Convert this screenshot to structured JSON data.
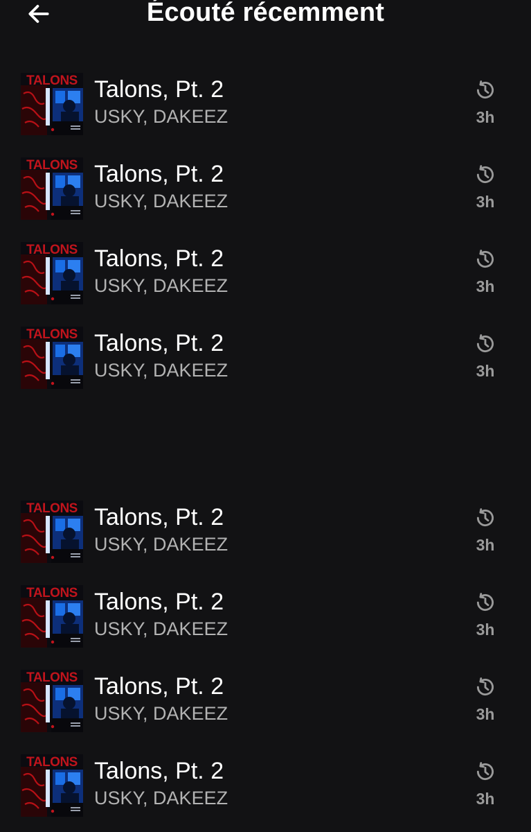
{
  "header": {
    "back_icon": "arrow-left-icon",
    "title": "Écouté récemment"
  },
  "tracks": [
    {
      "title": "Talons, Pt. 2",
      "artist": "USKY, DAKEEZ",
      "time": "3h",
      "cover_text": "TALONS",
      "icon": "history-icon"
    },
    {
      "title": "Talons, Pt. 2",
      "artist": "USKY, DAKEEZ",
      "time": "3h",
      "cover_text": "TALONS",
      "icon": "history-icon"
    },
    {
      "title": "Talons, Pt. 2",
      "artist": "USKY, DAKEEZ",
      "time": "3h",
      "cover_text": "TALONS",
      "icon": "history-icon"
    },
    {
      "title": "Talons, Pt. 2",
      "artist": "USKY, DAKEEZ",
      "time": "3h",
      "cover_text": "TALONS",
      "icon": "history-icon"
    },
    {
      "title": "Talons, Pt. 2",
      "artist": "USKY, DAKEEZ",
      "time": "3h",
      "cover_text": "TALONS",
      "icon": "history-icon"
    },
    {
      "title": "Talons, Pt. 2",
      "artist": "USKY, DAKEEZ",
      "time": "3h",
      "cover_text": "TALONS",
      "icon": "history-icon"
    },
    {
      "title": "Talons, Pt. 2",
      "artist": "USKY, DAKEEZ",
      "time": "3h",
      "cover_text": "TALONS",
      "icon": "history-icon"
    },
    {
      "title": "Talons, Pt. 2",
      "artist": "USKY, DAKEEZ",
      "time": "3h",
      "cover_text": "TALONS",
      "icon": "history-icon"
    }
  ],
  "colors": {
    "background": "#121214",
    "title_text": "#ffffff",
    "subtitle_text": "#b3b3b3",
    "meta_text": "#9a9a9a",
    "cover_red": "#c0141c",
    "cover_blue": "#1a6ee6"
  }
}
